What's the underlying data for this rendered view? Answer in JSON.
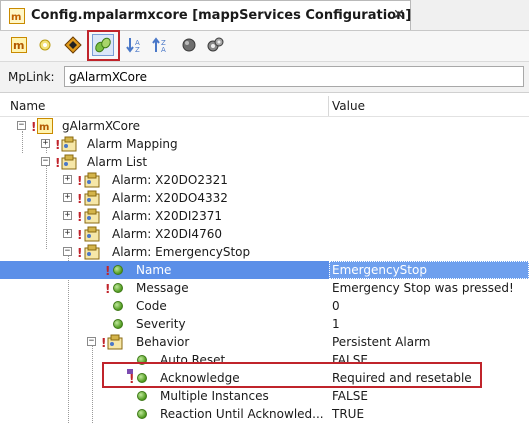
{
  "tab": {
    "title": "Config.mpalarmxcore [mappServices Configuration]",
    "close": "✕"
  },
  "toolbar": {
    "buttons": [
      "toggle-view-icon",
      "new-item-icon",
      "properties-icon",
      "link-icon",
      "sort-down-icon",
      "sort-up-icon",
      "record-icon",
      "settings-gears-icon"
    ],
    "active": "link-icon"
  },
  "mplink": {
    "label": "MpLink:",
    "value": "gAlarmXCore"
  },
  "columns": {
    "name": "Name",
    "value": "Value"
  },
  "tree": {
    "root": "gAlarmXCore",
    "alarm_mapping": "Alarm Mapping",
    "alarm_list": "Alarm List",
    "alarms": [
      "Alarm: X20DO2321",
      "Alarm: X20DO4332",
      "Alarm: X20DI2371",
      "Alarm: X20DI4760"
    ],
    "emergency": "Alarm: EmergencyStop",
    "props": [
      {
        "name": "Name",
        "value": "EmergencyStop"
      },
      {
        "name": "Message",
        "value": "Emergency Stop was pressed!"
      },
      {
        "name": "Code",
        "value": "0"
      },
      {
        "name": "Severity",
        "value": "1"
      },
      {
        "name": "Behavior",
        "value": "Persistent Alarm"
      }
    ],
    "behavior": [
      {
        "name": "Auto Reset",
        "value": "FALSE"
      },
      {
        "name": "Acknowledge",
        "value": "Required and resetable"
      },
      {
        "name": "Multiple Instances",
        "value": "FALSE"
      },
      {
        "name": "Reaction Until Acknowled...",
        "value": "TRUE"
      }
    ]
  },
  "colors": {
    "selection": "#5b8fe8",
    "highlight": "#c0242b",
    "excl": "#c0242b"
  }
}
